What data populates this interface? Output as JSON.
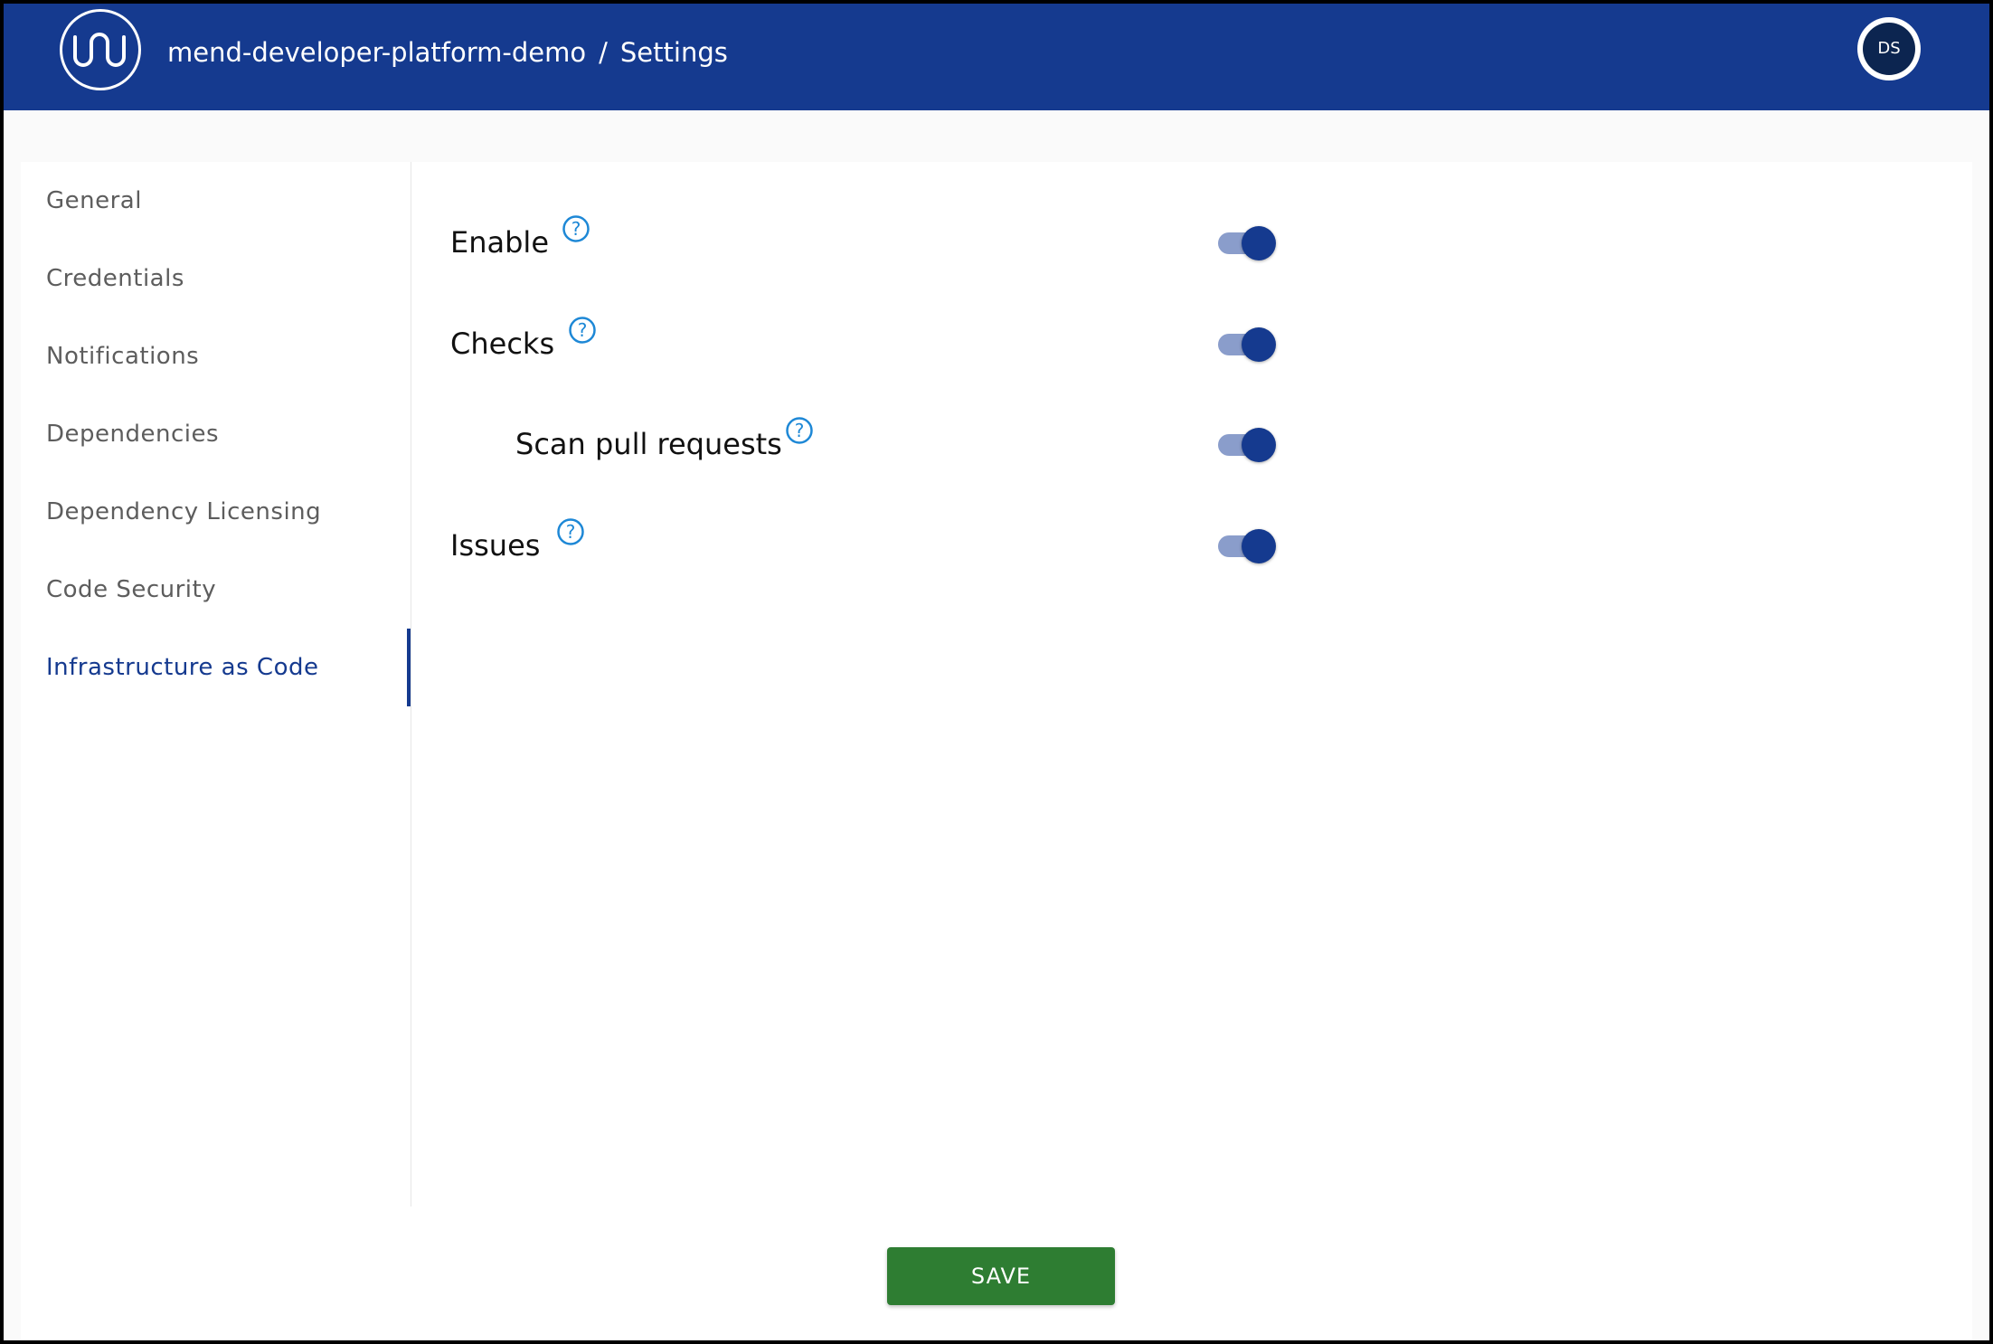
{
  "header": {
    "project": "mend-developer-platform-demo",
    "separator": "/",
    "page": "Settings",
    "avatar_initials": "DS",
    "logo_icon": "mend-logo-icon"
  },
  "sidebar": {
    "items": [
      {
        "label": "General",
        "active": false
      },
      {
        "label": "Credentials",
        "active": false
      },
      {
        "label": "Notifications",
        "active": false
      },
      {
        "label": "Dependencies",
        "active": false
      },
      {
        "label": "Dependency Licensing",
        "active": false
      },
      {
        "label": "Code Security",
        "active": false
      },
      {
        "label": "Infrastructure as Code",
        "active": true
      }
    ]
  },
  "settings": [
    {
      "label": "Enable",
      "enabled": true,
      "icon": "help-icon"
    },
    {
      "label": "Checks",
      "enabled": true,
      "icon": "help-icon"
    },
    {
      "label": "Scan pull requests",
      "enabled": true,
      "icon": "help-icon"
    },
    {
      "label": "Issues",
      "enabled": true,
      "icon": "help-icon"
    }
  ],
  "actions": {
    "save_label": "SAVE"
  },
  "colors": {
    "header_bg": "#153a8f",
    "accent": "#153a8f",
    "save_bg": "#2e7d32",
    "help_icon": "#1e88d6"
  }
}
